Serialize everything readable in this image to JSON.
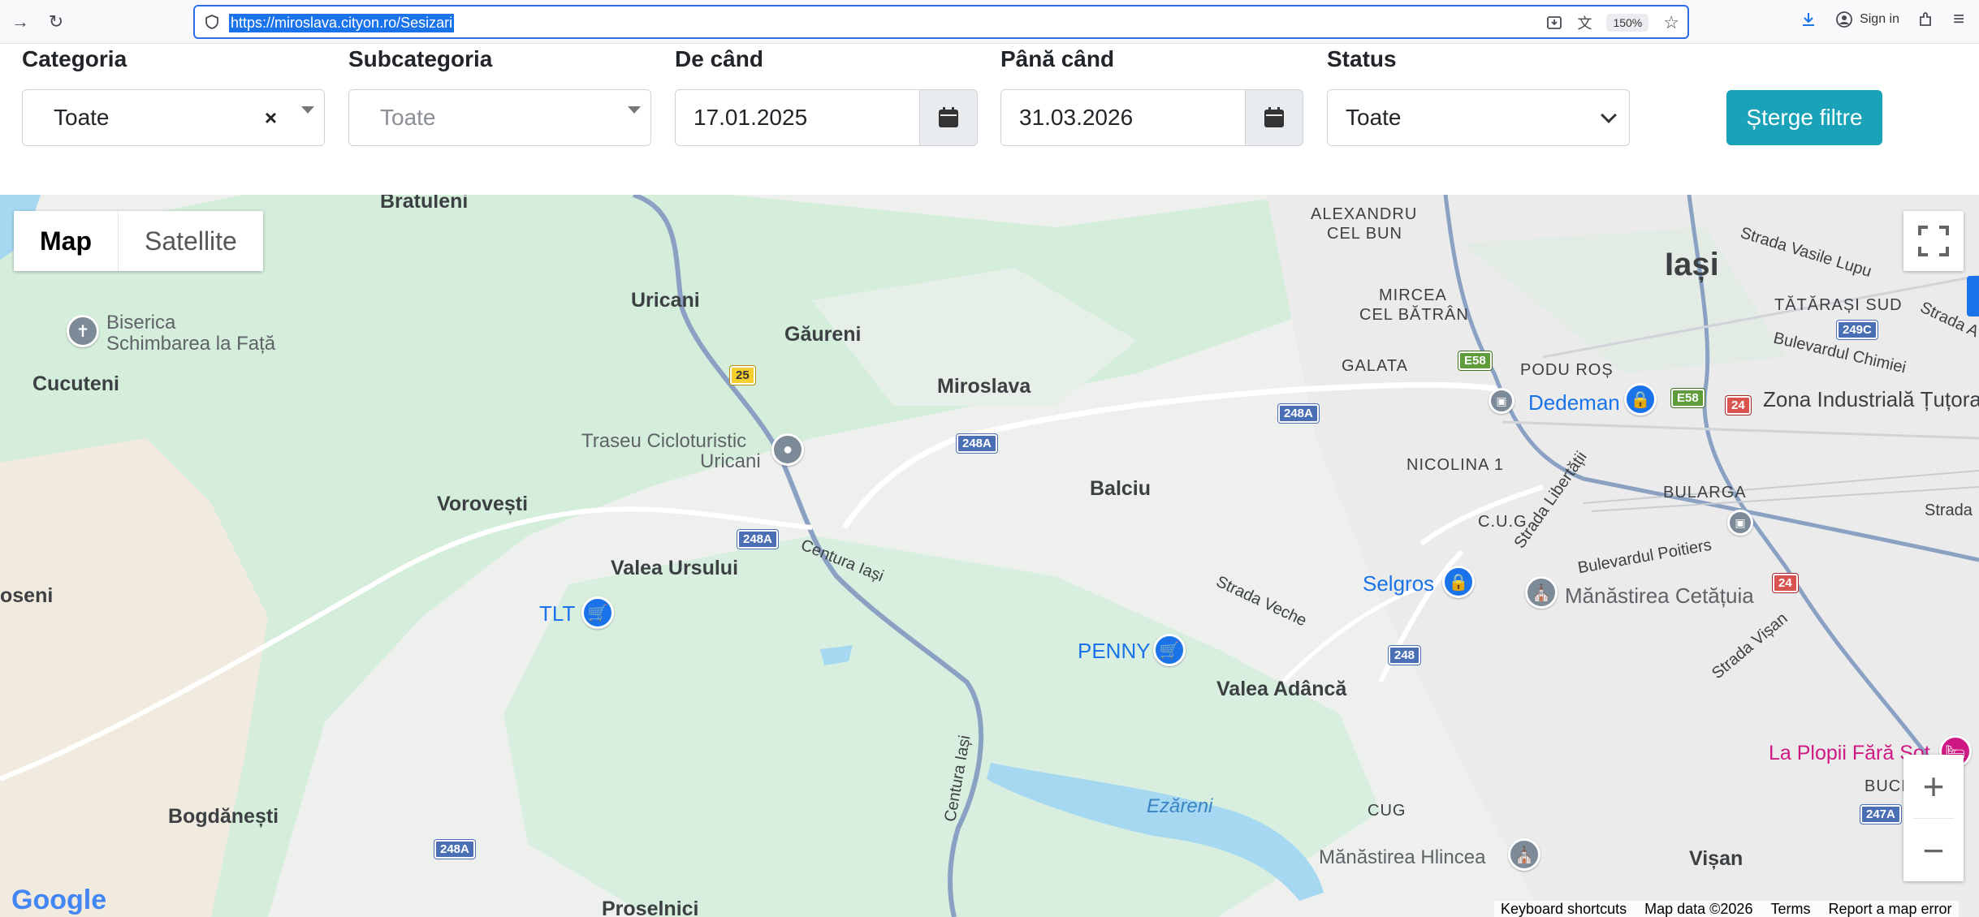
{
  "browser": {
    "url": "https://miroslava.cityon.ro/Sesizari",
    "zoom": "150%",
    "signin_label": "Sign in"
  },
  "filters": {
    "categoria": {
      "label": "Categoria",
      "value": "Toate",
      "clear": "×"
    },
    "subcategoria": {
      "label": "Subcategoria",
      "placeholder": "Toate"
    },
    "de_cand": {
      "label": "De când",
      "value": "17.01.2025"
    },
    "pana_cand": {
      "label": "Până când",
      "value": "31.03.2026"
    },
    "status": {
      "label": "Status",
      "value": "Toate"
    },
    "clear_button": "Șterge filtre",
    "accent_color": "#1aa2b8"
  },
  "map": {
    "type_map": "Map",
    "type_satellite": "Satellite",
    "places": {
      "bratuleni": "Bratuleni",
      "uricani": "Uricani",
      "gaureni": "Găureni",
      "miroslava": "Miroslava",
      "cucuteni": "Cucuteni",
      "biserica1": "Biserica",
      "biserica2": "Schimbarea la Față",
      "traseu1": "Traseu Cicloturistic",
      "traseu2": "Uricani",
      "vorovesti": "Vorovești",
      "valea_ursului": "Valea Ursului",
      "oseni": "oseni",
      "tlt": "TLT",
      "balciu": "Balciu",
      "penny": "PENNY",
      "valea_adanca": "Valea Adâncă",
      "bogdanesti": "Bogdănești",
      "proselnici": "Proselnici",
      "ezareni": "Ezăreni",
      "cug": "CUG",
      "hlincea": "Mănăstirea Hlincea",
      "visan": "Vișan",
      "buci": "BUCI",
      "la_plopii": "La Plopii Fără Soț",
      "alexandru1": "ALEXANDRU",
      "alexandru2": "CEL BUN",
      "mircea1": "MIRCEA",
      "mircea2": "CEL BĂTRÂN",
      "iasi": "Iași",
      "tatarasi": "TĂTĂRAȘI SUD",
      "galata": "GALATA",
      "podu_ros": "PODU ROȘ",
      "dedeman": "Dedeman",
      "zona_ind": "Zona Industrială Țuțora",
      "nicolina": "NICOLINA 1",
      "bularga": "BULARGA",
      "cug2": "C.U.G.",
      "selgros": "Selgros",
      "cetatuia": "Mănăstirea Cetățuia",
      "strada_veche": "Strada Veche",
      "centura1": "Centura Iași",
      "centura2": "Centura Iași",
      "vasile_lupu": "Strada Vasile Lupu",
      "chimiei": "Bulevardul Chimiei",
      "poitiers": "Bulevardul Poitiers",
      "libertatii": "Strada Libertății",
      "visan_str": "Strada Vișan",
      "strada_r": "Strada",
      "strada_a": "Strada A"
    },
    "shields": {
      "r25": "25",
      "r248a_1": "248A",
      "r248a_2": "248A",
      "r248a_3": "248A",
      "r248a_4": "248A",
      "r248": "248",
      "e58_1": "E58",
      "e58_2": "E58",
      "r24_1": "24",
      "r24_2": "24",
      "r249c": "249C",
      "r247a": "247A"
    },
    "zoom_in": "+",
    "zoom_out": "−",
    "google": "Google",
    "attribution": {
      "shortcuts": "Keyboard shortcuts",
      "data": "Map data ©2026",
      "terms": "Terms",
      "report": "Report a map error"
    }
  }
}
